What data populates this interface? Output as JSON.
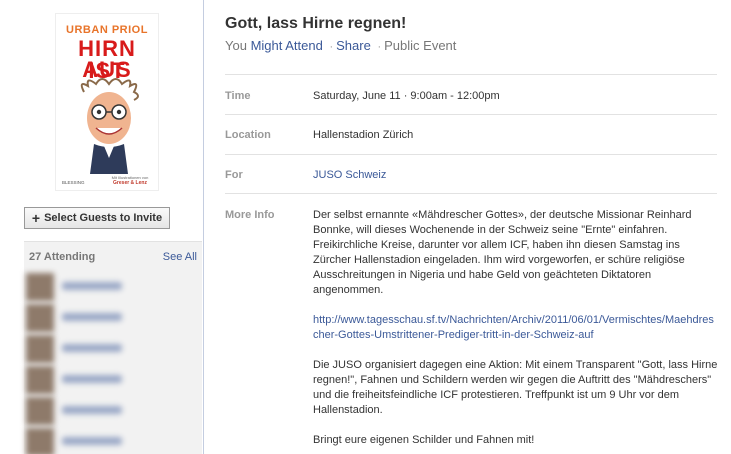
{
  "book": {
    "author": "URBAN PRIOL",
    "title_line1": "HIRN IST",
    "title_line2": "AUS",
    "publisher": "BLESSING",
    "illustrations": "Mit Illustrationen von",
    "illustrator": "Greser & Lenz"
  },
  "sidebar": {
    "select_guests_label": "Select Guests to Invite",
    "attending_count": "27 Attending",
    "see_all": "See All"
  },
  "event": {
    "title": "Gott, lass Hirne regnen!",
    "rsvp_prefix": "You",
    "rsvp_status": "Might Attend",
    "share": "Share",
    "privacy": "Public Event",
    "separator": "·",
    "time_label": "Time",
    "time_value": "Saturday, June 11 · 9:00am - 12:00pm",
    "location_label": "Location",
    "location_value": "Hallenstadion Zürich",
    "for_label": "For",
    "for_value": "JUSO Schweiz",
    "more_info_label": "More Info",
    "more_info_p1": "Der selbst ernannte «Mähdrescher Gottes», der deutsche Missionar Reinhard Bonnke, will dieses Wochenende in der Schweiz seine \"Ernte\" einfahren. Freikirchliche Kreise, darunter vor allem ICF, haben ihn diesen Samstag ins Zürcher Hallenstadion eingeladen. Ihm wird vorgeworfen, er schüre religiöse Ausschreitungen in Nigeria und habe Geld von geächteten Diktatoren angenommen.",
    "more_info_url": "http://www.tagesschau.sf.tv/Nachrichten/Archiv/2011/06/01/Vermischtes/Maehdrescher-Gottes-Umstrittener-Prediger-tritt-in-der-Schweiz-auf",
    "more_info_p2": "Die JUSO organisiert dagegen eine Aktion: Mit einem Transparent \"Gott, lass Hirne regnen!\", Fahnen und Schildern werden wir gegen die Auftritt des \"Mähdreschers\" und die freiheitsfeindliche ICF protestieren. Treffpunkt ist um 9 Uhr vor dem Hallenstadion.",
    "more_info_p3": "Bringt eure eigenen Schilder und Fahnen mit!"
  },
  "colors": {
    "link": "#3b5998",
    "label_gray": "#999999",
    "book_title_red": "#d81b1b",
    "book_author_orange": "#e8742a"
  }
}
